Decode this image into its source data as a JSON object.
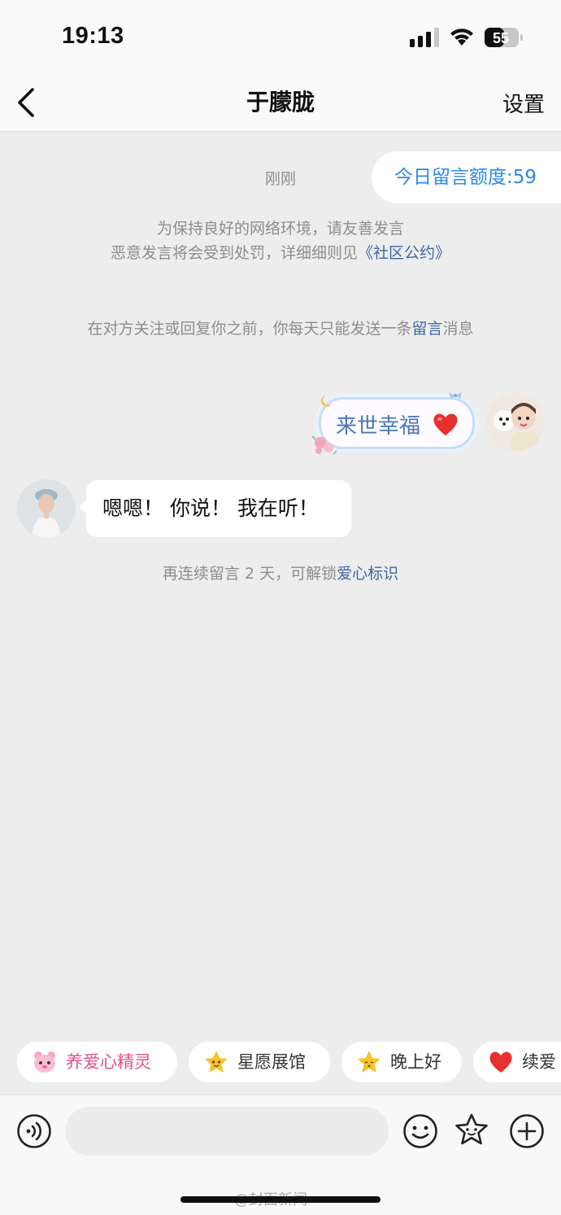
{
  "status_bar": {
    "time": "19:13",
    "battery": "55",
    "icons": [
      "cellular-signal-icon",
      "wifi-icon",
      "battery-icon"
    ]
  },
  "nav": {
    "back_icon": "chevron-left-icon",
    "title": "于朦胧",
    "settings_label": "设置"
  },
  "quota": {
    "label": "今日留言额度:59"
  },
  "chat": {
    "timestamp": "刚刚",
    "notice_line1": "为保持良好的网络环境，请友善发言",
    "notice_line2_prefix": "恶意发言将会受到处罚，详细细则见",
    "notice_link": "《社区公约》",
    "rule_prefix": "在对方关注或回复你之前，你每天只能发送一条",
    "rule_link": "留言",
    "rule_suffix": "消息",
    "my_message": "来世幸福",
    "my_message_emoji": "red-heart-icon",
    "their_message": "嗯嗯！ 你说！ 我在听！",
    "streak_prefix": "再连续留言 2 天，可解锁",
    "streak_link": "爱心标识"
  },
  "quick_chips": [
    {
      "label": "养爱心精灵",
      "icon": "pink-sprite-icon"
    },
    {
      "label": "星愿展馆",
      "icon": "star-face-icon"
    },
    {
      "label": "晚上好",
      "icon": "sleepy-star-icon"
    },
    {
      "label": "续爱",
      "icon": "red-heart-icon"
    }
  ],
  "input_bar": {
    "placeholder": "",
    "icons": [
      "voice-icon",
      "emoji-icon",
      "star-sticker-icon",
      "plus-icon"
    ]
  },
  "watermark": "@封面新闻",
  "colors": {
    "accent_blue": "#2b8ae8",
    "link_blue": "#3f66a8",
    "background": "#ededed",
    "pink": "#e0508f"
  }
}
